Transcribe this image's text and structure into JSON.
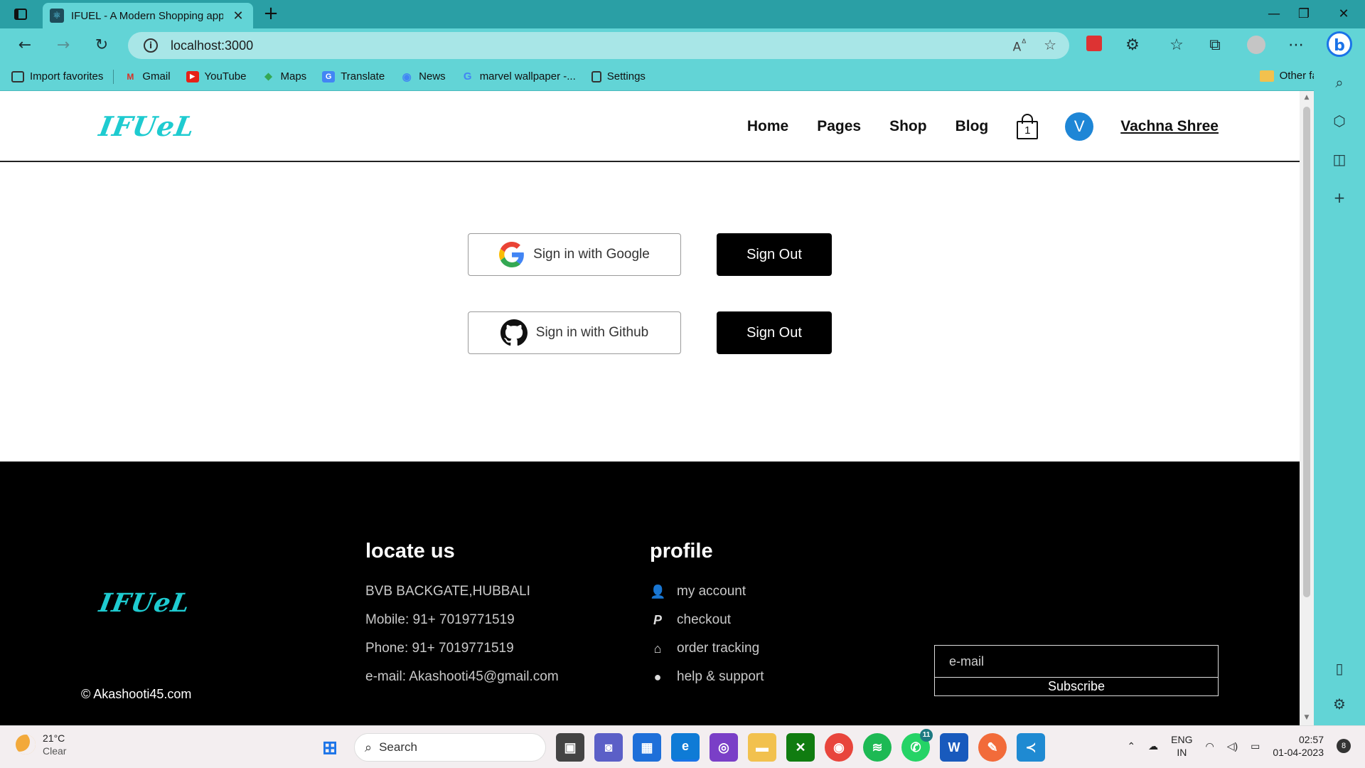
{
  "browser": {
    "tab_title": "IFUEL - A Modern Shopping app",
    "url": "localhost:3000",
    "favorites": [
      {
        "label": "Import favorites",
        "icon": "import-icon"
      },
      {
        "label": "Gmail",
        "icon": "gmail-icon"
      },
      {
        "label": "YouTube",
        "icon": "youtube-icon"
      },
      {
        "label": "Maps",
        "icon": "maps-icon"
      },
      {
        "label": "Translate",
        "icon": "translate-icon"
      },
      {
        "label": "News",
        "icon": "news-icon"
      },
      {
        "label": "marvel wallpaper -...",
        "icon": "google-icon"
      },
      {
        "label": "Settings",
        "icon": "document-icon"
      }
    ],
    "other_favorites": "Other favorites",
    "accent_color": "#62d4d6"
  },
  "site": {
    "logo": "IFUeL",
    "nav": {
      "home": "Home",
      "pages": "Pages",
      "shop": "Shop",
      "blog": "Blog"
    },
    "cart_count": "1",
    "avatar_initial": "V",
    "username": "Vachna Shree"
  },
  "auth": {
    "google_label": "Sign in with Google",
    "github_label": "Sign in with Github",
    "signout_label": "Sign Out"
  },
  "footer": {
    "logo": "IFUeL",
    "locate": {
      "heading": "locate us",
      "lines": [
        "BVB BACKGATE,HUBBALI",
        "Mobile: 91+ 7019771519",
        "Phone: 91+ 7019771519",
        "e-mail: Akashooti45@gmail.com"
      ]
    },
    "profile": {
      "heading": "profile",
      "items": [
        {
          "label": "my account",
          "icon": "user-icon"
        },
        {
          "label": "checkout",
          "icon": "paypal-icon"
        },
        {
          "label": "order tracking",
          "icon": "home-icon"
        },
        {
          "label": "help & support",
          "icon": "location-pin-icon"
        }
      ]
    },
    "email_placeholder": "e-mail",
    "subscribe_label": "Subscribe",
    "copyright": "© Akashooti45.com"
  },
  "taskbar": {
    "weather_temp": "21°C",
    "weather_desc": "Clear",
    "search_label": "Search",
    "lang_line1": "ENG",
    "lang_line2": "IN",
    "time": "02:57",
    "date": "01-04-2023",
    "notification_count": "8",
    "whatsapp_badge": "11"
  }
}
